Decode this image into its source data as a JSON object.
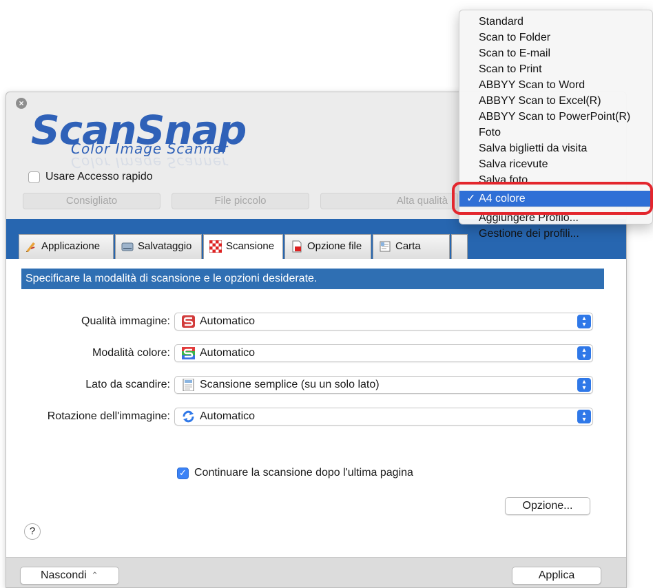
{
  "window": {
    "close_symbol": "×",
    "logo_brand": "ScanSnap",
    "logo_subtitle": "Color Image Scanner",
    "quick_access_label": "Usare Accesso rapido",
    "presets": [
      "Consigliato",
      "File piccolo",
      "Alta qualità"
    ]
  },
  "tabs": [
    {
      "label": "Applicazione",
      "icon": "pencil-icon",
      "active": false
    },
    {
      "label": "Salvataggio",
      "icon": "drive-icon",
      "active": false
    },
    {
      "label": "Scansione",
      "icon": "checker-icon",
      "active": true
    },
    {
      "label": "Opzione file",
      "icon": "document-icon",
      "active": false
    },
    {
      "label": "Carta",
      "icon": "paper-icon",
      "active": false
    }
  ],
  "content": {
    "instruction": "Specificare la modalità di scansione e le opzioni desiderate.",
    "rows": [
      {
        "label": "Qualità immagine:",
        "value": "Automatico",
        "icon": "scan-quality-icon"
      },
      {
        "label": "Modalità colore:",
        "value": "Automatico",
        "icon": "color-mode-icon"
      },
      {
        "label": "Lato da scandire:",
        "value": "Scansione semplice (su un solo lato)",
        "icon": "single-side-icon"
      },
      {
        "label": "Rotazione dell'immagine:",
        "value": "Automatico",
        "icon": "rotation-icon"
      }
    ],
    "continue_label": "Continuare la scansione dopo l'ultima pagina",
    "continue_checked": true,
    "option_button": "Opzione...",
    "help_symbol": "?"
  },
  "bottom_bar": {
    "hide_button": "Nascondi",
    "hide_chevron": "⌃",
    "apply_button": "Applica"
  },
  "menu": {
    "items": [
      "Standard",
      "Scan to Folder",
      "Scan to E-mail",
      "Scan to Print",
      "ABBYY Scan to Word",
      "ABBYY Scan to Excel(R)",
      "ABBYY Scan to PowerPoint(R)",
      "Foto",
      "Salva biglietti da visita",
      "Salva ricevute",
      "Salva foto"
    ],
    "selected": "A4 colore",
    "check_symbol": "✓",
    "actions": [
      "Aggiungere Profilo...",
      "Gestione dei profili..."
    ]
  },
  "colors": {
    "accent_blue": "#2766b0",
    "selection_blue": "#2f6fd6",
    "highlight_red": "#e3262d"
  }
}
